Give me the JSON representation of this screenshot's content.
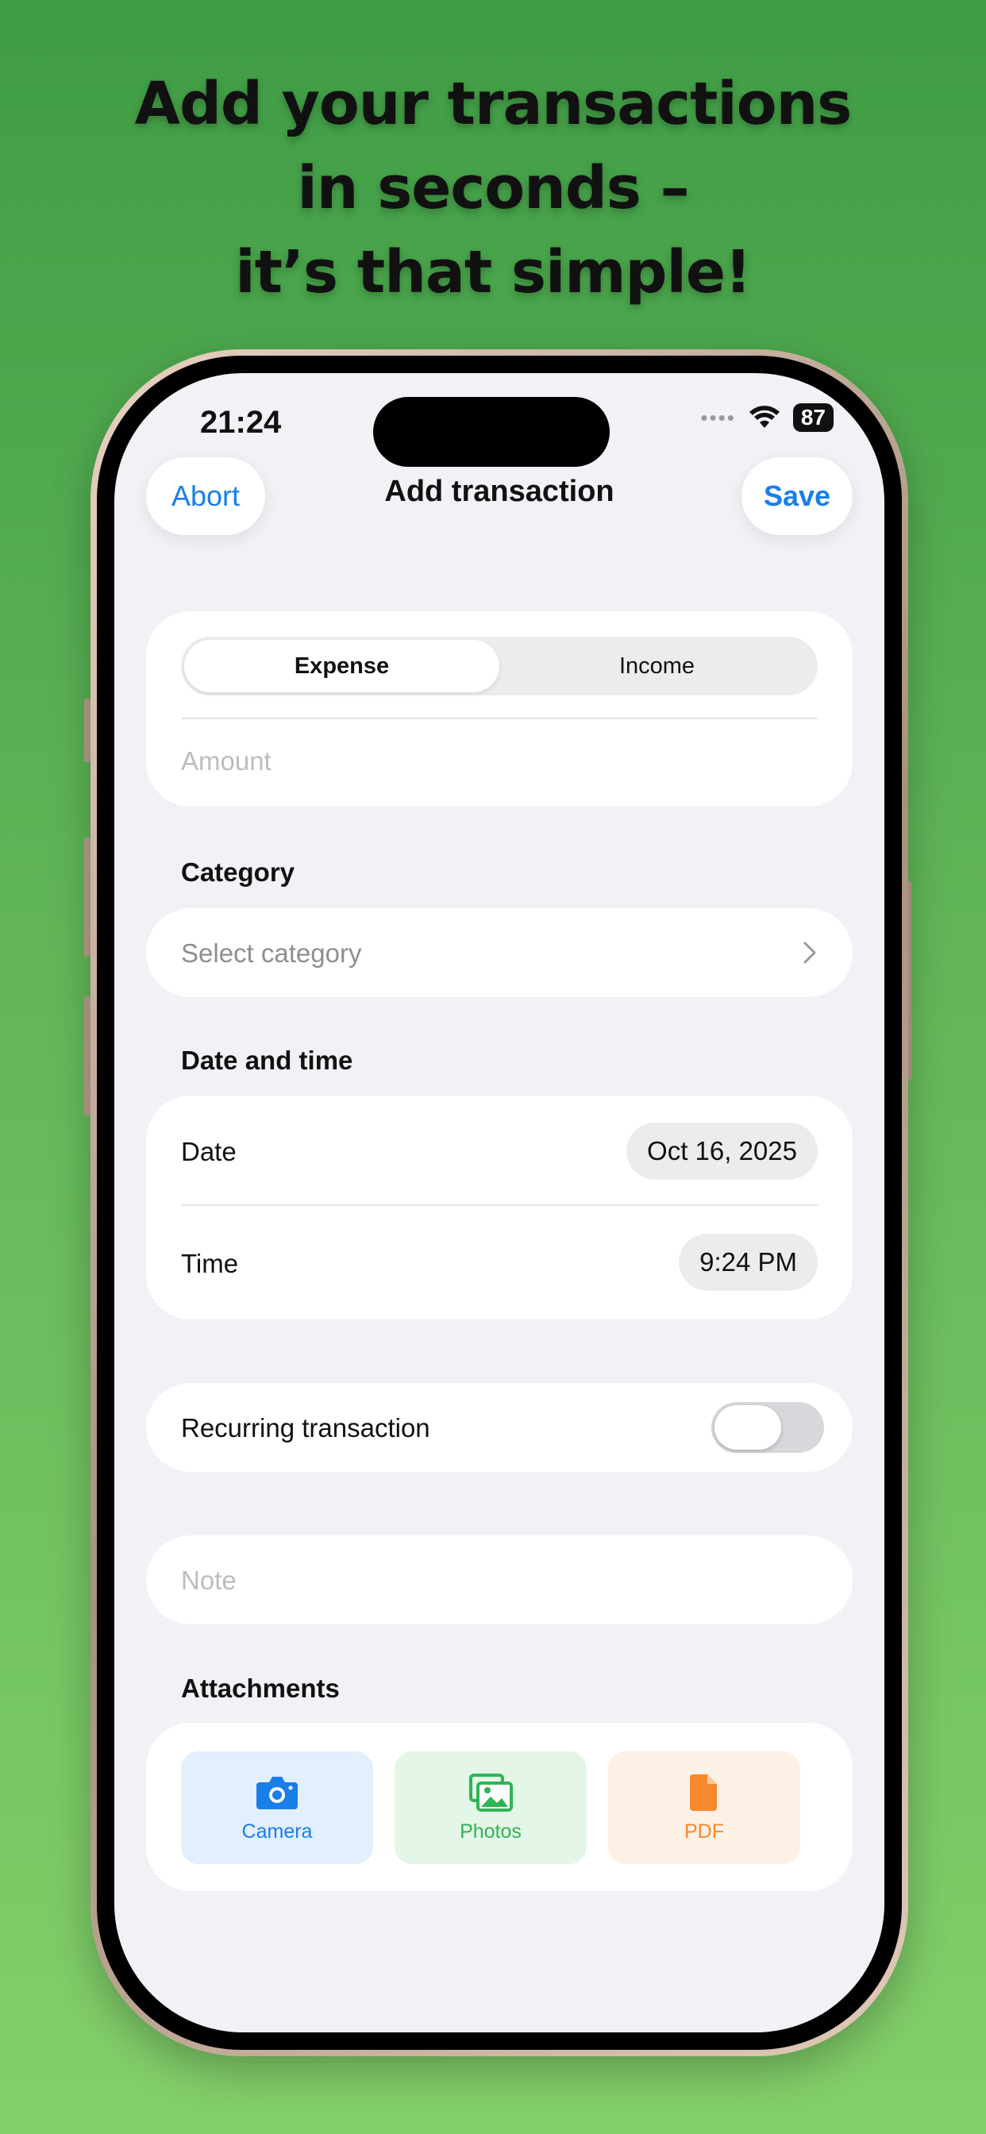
{
  "headline": [
    "Add your transactions",
    "in seconds –",
    "it’s that simple!"
  ],
  "status_bar": {
    "time": "21:24",
    "battery": "87"
  },
  "nav": {
    "abort_label": "Abort",
    "title": "Add transaction",
    "save_label": "Save"
  },
  "type_segment": {
    "options": [
      "Expense",
      "Income"
    ],
    "selected": "Expense"
  },
  "amount": {
    "placeholder": "Amount"
  },
  "category": {
    "section_label": "Category",
    "placeholder": "Select category"
  },
  "datetime": {
    "section_label": "Date and time",
    "date_label": "Date",
    "date_value": "Oct 16, 2025",
    "time_label": "Time",
    "time_value": "9:24 PM"
  },
  "recurring": {
    "label": "Recurring transaction",
    "enabled": false
  },
  "note": {
    "placeholder": "Note"
  },
  "attachments": {
    "section_label": "Attachments",
    "items": [
      {
        "label": "Camera",
        "icon": "camera-icon",
        "color": "#1a7ee8",
        "bg": "#e2effc"
      },
      {
        "label": "Photos",
        "icon": "photos-icon",
        "color": "#2fb454",
        "bg": "#e3f6e7"
      },
      {
        "label": "PDF",
        "icon": "pdf-icon",
        "color": "#f5892c",
        "bg": "#fdf1e6"
      }
    ]
  },
  "colors": {
    "accent": "#1a7ee8",
    "background_top": "#3f9d45",
    "background_bottom": "#83cf6a"
  }
}
